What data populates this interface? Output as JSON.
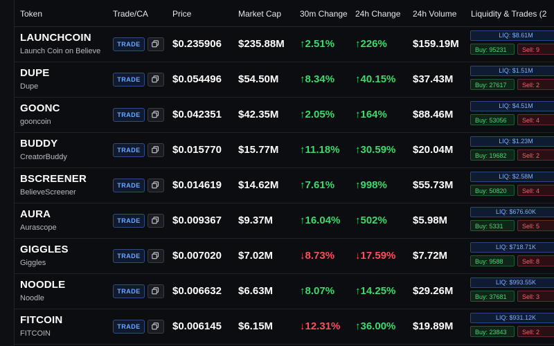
{
  "columns": {
    "token": "Token",
    "trade_ca": "Trade/CA",
    "price": "Price",
    "market_cap": "Market Cap",
    "change_30m": "30m Change",
    "change_24h": "24h Change",
    "volume_24h": "24h Volume",
    "liquidity_trades": "Liquidity & Trades (2"
  },
  "trade_label": "TRADE",
  "colors": {
    "up": "#3ed96b",
    "down": "#ff4d5e",
    "accent": "#6fa8ff"
  },
  "rows": [
    {
      "symbol": "LAUNCHCOIN",
      "name": "Launch Coin on Believe",
      "price": "$0.235906",
      "market_cap": "$235.88M",
      "c30": "2.51%",
      "c30_dir": "up",
      "c24": "226%",
      "c24_dir": "up",
      "volume": "$159.19M",
      "liq": "LIQ: $8.61M",
      "buy": "Buy: 95231",
      "sell": "Sell: 9"
    },
    {
      "symbol": "DUPE",
      "name": "Dupe",
      "price": "$0.054496",
      "market_cap": "$54.50M",
      "c30": "8.34%",
      "c30_dir": "up",
      "c24": "40.15%",
      "c24_dir": "up",
      "volume": "$37.43M",
      "liq": "LIQ: $1.51M",
      "buy": "Buy: 27617",
      "sell": "Sell: 2"
    },
    {
      "symbol": "GOONC",
      "name": "gooncoin",
      "price": "$0.042351",
      "market_cap": "$42.35M",
      "c30": "2.05%",
      "c30_dir": "up",
      "c24": "164%",
      "c24_dir": "up",
      "volume": "$88.46M",
      "liq": "LIQ: $4.51M",
      "buy": "Buy: 53056",
      "sell": "Sell: 4"
    },
    {
      "symbol": "BUDDY",
      "name": "CreatorBuddy",
      "price": "$0.015770",
      "market_cap": "$15.77M",
      "c30": "11.18%",
      "c30_dir": "up",
      "c24": "30.59%",
      "c24_dir": "up",
      "volume": "$20.04M",
      "liq": "LIQ: $1.23M",
      "buy": "Buy: 19682",
      "sell": "Sell: 2"
    },
    {
      "symbol": "BSCREENER",
      "name": "BelieveScreener",
      "price": "$0.014619",
      "market_cap": "$14.62M",
      "c30": "7.61%",
      "c30_dir": "up",
      "c24": "998%",
      "c24_dir": "up",
      "volume": "$55.73M",
      "liq": "LIQ: $2.58M",
      "buy": "Buy: 50820",
      "sell": "Sell: 4"
    },
    {
      "symbol": "AURA",
      "name": "Aurascope",
      "price": "$0.009367",
      "market_cap": "$9.37M",
      "c30": "16.04%",
      "c30_dir": "up",
      "c24": "502%",
      "c24_dir": "up",
      "volume": "$5.98M",
      "liq": "LIQ: $676.60K",
      "buy": "Buy: 5331",
      "sell": "Sell: 5"
    },
    {
      "symbol": "GIGGLES",
      "name": "Giggles",
      "price": "$0.007020",
      "market_cap": "$7.02M",
      "c30": "8.73%",
      "c30_dir": "down",
      "c24": "17.59%",
      "c24_dir": "down",
      "volume": "$7.72M",
      "liq": "LIQ: $718.71K",
      "buy": "Buy: 9588",
      "sell": "Sell: 8"
    },
    {
      "symbol": "NOODLE",
      "name": "Noodle",
      "price": "$0.006632",
      "market_cap": "$6.63M",
      "c30": "8.07%",
      "c30_dir": "up",
      "c24": "14.25%",
      "c24_dir": "up",
      "volume": "$29.26M",
      "liq": "LIQ: $993.55K",
      "buy": "Buy: 37681",
      "sell": "Sell: 3"
    },
    {
      "symbol": "FITCOIN",
      "name": "FITCOIN",
      "price": "$0.006145",
      "market_cap": "$6.15M",
      "c30": "12.31%",
      "c30_dir": "down",
      "c24": "36.00%",
      "c24_dir": "up",
      "volume": "$19.89M",
      "liq": "LIQ: $931.12K",
      "buy": "Buy: 23843",
      "sell": "Sell: 2"
    }
  ]
}
